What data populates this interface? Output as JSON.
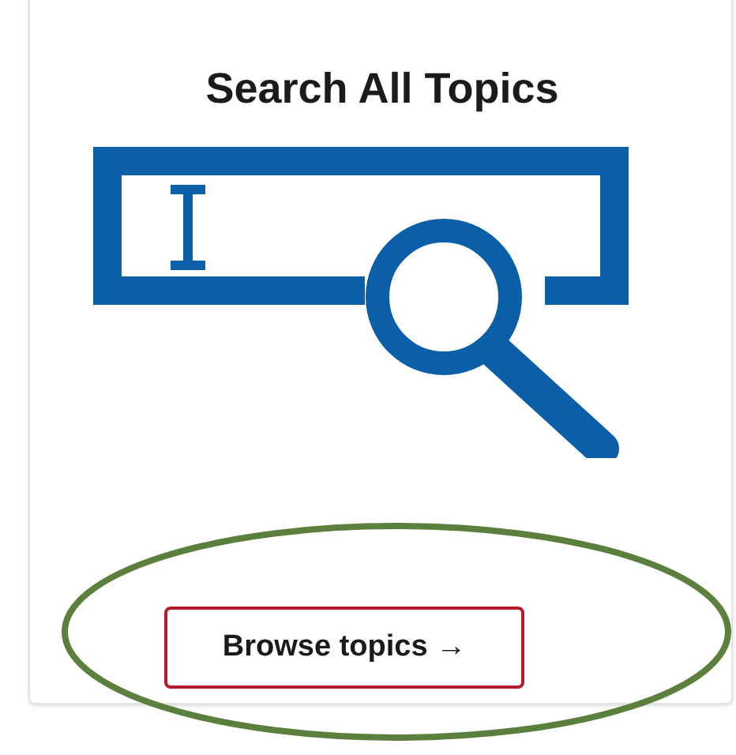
{
  "card": {
    "title": "Search All Topics",
    "button": {
      "label": "Browse topics →"
    }
  }
}
